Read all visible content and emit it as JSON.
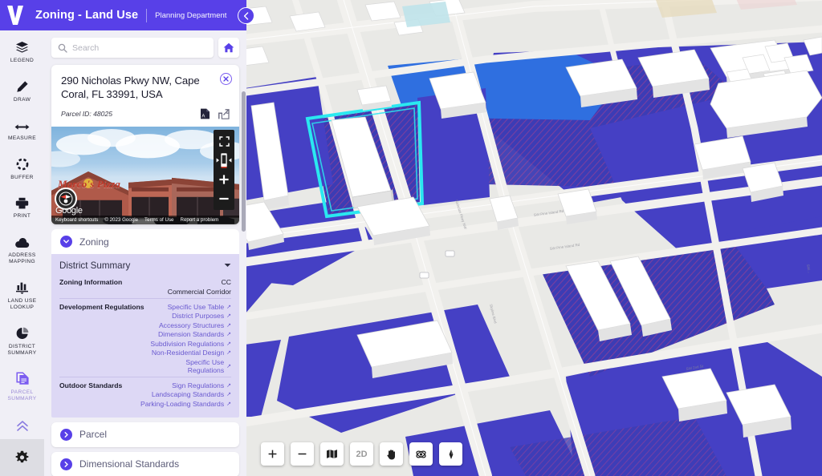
{
  "header": {
    "title": "Zoning - Land Use",
    "subtitle": "Planning Department",
    "logo_icon": "v-logo-icon",
    "collapse_icon": "chevron-left-icon",
    "brand_color": "#5840e8"
  },
  "sidebar": {
    "items": [
      {
        "label": "LEGEND",
        "icon": "layers-icon",
        "active": false
      },
      {
        "label": "DRAW",
        "icon": "pencil-icon",
        "active": false
      },
      {
        "label": "MEASURE",
        "icon": "arrows-horizontal-icon",
        "active": false
      },
      {
        "label": "BUFFER",
        "icon": "dashed-circle-icon",
        "active": false
      },
      {
        "label": "PRINT",
        "icon": "printer-icon",
        "active": false
      },
      {
        "label": "ADDRESS MAPPING",
        "icon": "cloud-upload-icon",
        "active": false
      },
      {
        "label": "LAND USE LOOKUP",
        "icon": "bar-chart-icon",
        "active": false
      },
      {
        "label": "DISTRICT SUMMARY",
        "icon": "pie-chart-icon",
        "active": false
      },
      {
        "label": "PARCEL SUMMARY",
        "icon": "document-icon",
        "active": true
      }
    ],
    "collapse_icon": "double-chevron-up-icon",
    "settings_icon": "gear-icon"
  },
  "search": {
    "placeholder": "Search",
    "value": "",
    "icon": "search-icon",
    "home_icon": "home-icon"
  },
  "parcel_card": {
    "address": "290 Nicholas Pkwy NW, Cape Coral, FL 33991, USA",
    "parcel_id_label": "Parcel ID: 48025",
    "close_icon": "close-icon",
    "pdf_icon": "pdf-icon",
    "share_icon": "share-icon"
  },
  "street_view": {
    "business_label": "Marco's Pizza",
    "google_label": "Google",
    "compass_icon": "compass-icon",
    "fullscreen_icon": "fullscreen-icon",
    "pano_icon": "pano-icon",
    "zoom_in_icon": "plus-icon",
    "zoom_out_icon": "minus-icon",
    "credits": [
      "Keyboard shortcuts",
      "© 2023 Google",
      "Terms of Use",
      "Report a problem"
    ]
  },
  "accordions": [
    {
      "title": "Zoning",
      "open": true,
      "icon": "chevron-down-icon"
    },
    {
      "title": "Parcel",
      "open": false,
      "icon": "chevron-right-icon"
    },
    {
      "title": "Dimensional Standards",
      "open": false,
      "icon": "chevron-right-icon"
    }
  ],
  "district_summary": {
    "title": "District Summary",
    "caret_icon": "caret-down-icon",
    "rows": [
      {
        "label": "Zoning Information",
        "values": [
          "CC",
          "Commercial Corridor"
        ],
        "links": []
      },
      {
        "label": "Development Regulations",
        "values": [],
        "links": [
          "Specific Use Table",
          "District Purposes",
          "Accessory Structures",
          "Dimension Standards",
          "Subdivision Regulations",
          "Non-Residential Design",
          "Specific Use Regulations"
        ]
      },
      {
        "label": "Outdoor Standards",
        "values": [],
        "links": [
          "Sign Regulations",
          "Landscaping Standards",
          "Parking-Loading Standards"
        ]
      }
    ],
    "external_link_icon": "external-link-icon"
  },
  "map_toolbar": {
    "buttons": [
      {
        "label": "+",
        "icon": "plus-icon",
        "name": "zoom-in"
      },
      {
        "label": "−",
        "icon": "minus-icon",
        "name": "zoom-out"
      },
      {
        "label": "",
        "icon": "basemap-icon",
        "name": "basemap"
      },
      {
        "label": "2D",
        "icon": "2d-icon",
        "name": "toggle-2d"
      },
      {
        "label": "",
        "icon": "pan-hand-icon",
        "name": "pan"
      },
      {
        "label": "",
        "icon": "orbit-icon",
        "name": "orbit"
      },
      {
        "label": "",
        "icon": "compass-needle-icon",
        "name": "compass"
      }
    ]
  },
  "map": {
    "selected_parcel_outline_color": "#2ae8f0",
    "zone_fill_color": "#4040c8",
    "zone_hatch_color": "#6b3a8f",
    "highlight_fill_color": "#2f6fe0",
    "road_color": "#f2f1ee",
    "background_color": "#e9e9e6"
  }
}
